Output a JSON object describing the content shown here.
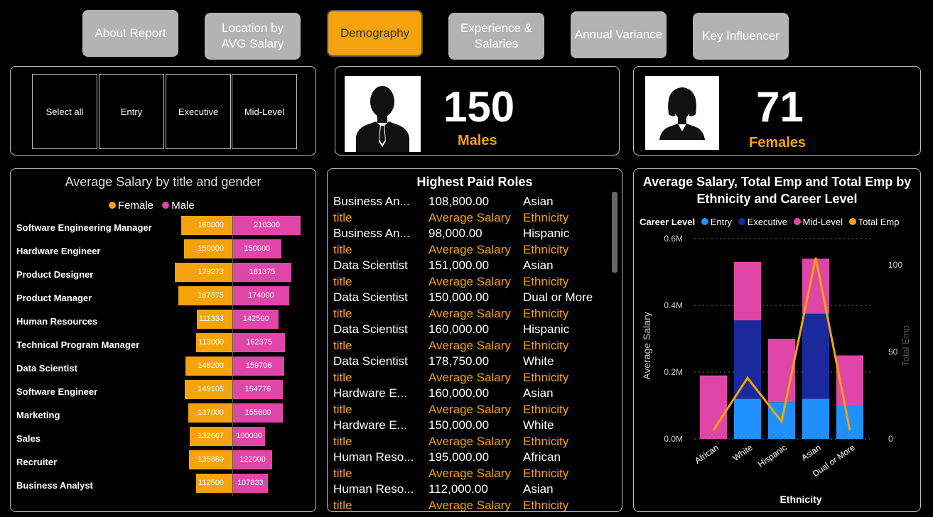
{
  "nav": [
    {
      "label": "About Report",
      "active": false
    },
    {
      "label": "Location by AVG Salary",
      "active": false
    },
    {
      "label": "Demography",
      "active": true
    },
    {
      "label": "Experience & Salaries",
      "active": false
    },
    {
      "label": "Annual Variance",
      "active": false
    },
    {
      "label": "Key Influencer",
      "active": false
    }
  ],
  "slicer": [
    "Select all",
    "Entry",
    "Executive",
    "Mid-Level"
  ],
  "kpi": {
    "males": {
      "value": "150",
      "label": "Males"
    },
    "females": {
      "value": "71",
      "label": "Females"
    }
  },
  "colors": {
    "female": "#f5a30c",
    "male": "#e046a8",
    "entry": "#1e90ff",
    "executive": "#1a2a9c",
    "midlevel": "#e046a8",
    "total": "#f5a30c"
  },
  "chart_data": [
    {
      "type": "bar",
      "title": "Average Salary by title and gender",
      "legend": [
        "Female",
        "Male"
      ],
      "categories": [
        "Software Engineering Manager",
        "Hardware Engineer",
        "Product Designer",
        "Product Manager",
        "Human Resources",
        "Technical Program Manager",
        "Data Scientist",
        "Software Engineer",
        "Marketing",
        "Sales",
        "Recruiter",
        "Business Analyst"
      ],
      "series": [
        {
          "name": "Female",
          "values": [
            160000,
            150000,
            179273,
            167875,
            111333,
            113000,
            146200,
            149105,
            137000,
            132667,
            135889,
            112500
          ]
        },
        {
          "name": "Male",
          "values": [
            210300,
            150000,
            181375,
            174000,
            142500,
            162375,
            159706,
            154776,
            155600,
            100000,
            122000,
            107833
          ]
        }
      ]
    },
    {
      "type": "table",
      "title": "Highest Paid Roles",
      "field_labels": {
        "title": "title",
        "salary": "Average Salary",
        "ethnicity": "Ethnicity"
      },
      "rows": [
        {
          "title": "Business An...",
          "salary": "108,800.00",
          "ethnicity": "Asian"
        },
        {
          "title": "Business An...",
          "salary": "98,000.00",
          "ethnicity": "Hispanic"
        },
        {
          "title": "Data Scientist",
          "salary": "151,000.00",
          "ethnicity": "Asian"
        },
        {
          "title": "Data Scientist",
          "salary": "150,000.00",
          "ethnicity": "Dual or More"
        },
        {
          "title": "Data Scientist",
          "salary": "160,000.00",
          "ethnicity": "Hispanic"
        },
        {
          "title": "Data Scientist",
          "salary": "178,750.00",
          "ethnicity": "White"
        },
        {
          "title": "Hardware E...",
          "salary": "160,000.00",
          "ethnicity": "Asian"
        },
        {
          "title": "Hardware E...",
          "salary": "150,000.00",
          "ethnicity": "White"
        },
        {
          "title": "Human Reso...",
          "salary": "195,000.00",
          "ethnicity": "African"
        },
        {
          "title": "Human Reso...",
          "salary": "112,000.00",
          "ethnicity": "Asian"
        }
      ]
    },
    {
      "type": "bar",
      "title": "Average Salary, Total Emp and Total Emp by Ethnicity and Career Level",
      "legend_title": "Career Level",
      "legend": [
        "Entry",
        "Executive",
        "Mid-Level",
        "Total Emp"
      ],
      "xlabel": "Ethnicity",
      "ylabel": "Average Salary",
      "y2label": "Total Emp",
      "categories": [
        "African",
        "White",
        "Hispanic",
        "Asian",
        "Dual or More"
      ],
      "ylim": [
        0,
        600000
      ],
      "y2lim": [
        0,
        115
      ],
      "yticks": [
        "0.0M",
        "0.2M",
        "0.4M",
        "0.6M"
      ],
      "y2ticks": [
        "0",
        "50",
        "100"
      ],
      "series": [
        {
          "name": "Entry",
          "values": [
            0,
            120000,
            110000,
            120000,
            100000
          ]
        },
        {
          "name": "Executive",
          "values": [
            0,
            235000,
            0,
            255000,
            0
          ]
        },
        {
          "name": "Mid-Level",
          "values": [
            190000,
            175000,
            190000,
            165000,
            150000
          ]
        },
        {
          "name": "Total Emp",
          "values": [
            5,
            35,
            10,
            104,
            5
          ]
        }
      ]
    }
  ]
}
